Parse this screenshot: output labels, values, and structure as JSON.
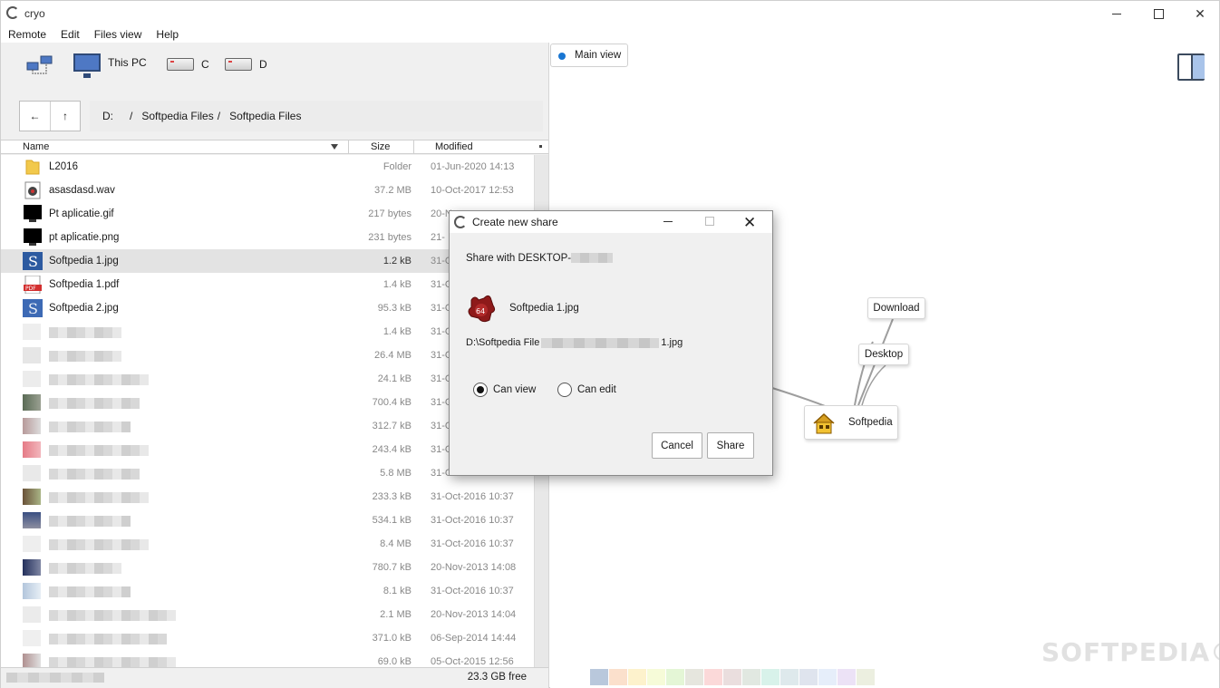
{
  "window": {
    "title": "cryo"
  },
  "menu": [
    "Remote",
    "Edit",
    "Files view",
    "Help"
  ],
  "drives": {
    "this_pc": "This PC",
    "c": "C",
    "d": "D"
  },
  "breadcrumb": {
    "root": "D:",
    "sep": "/",
    "part1": "Softpedia Files",
    "part2": "Softpedia Files"
  },
  "nav": {
    "back": "←",
    "up": "↑"
  },
  "columns": {
    "name": "Name",
    "size": "Size",
    "modified": "Modified"
  },
  "files": [
    {
      "name": "L2016",
      "size": "Folder",
      "modified": "01-Jun-2020  14:13",
      "icon": "folder-icon"
    },
    {
      "name": "asasdasd.wav",
      "size": "37.2 MB",
      "modified": "10-Oct-2017  12:53",
      "icon": "audio-file-icon"
    },
    {
      "name": "Pt aplicatie.gif",
      "size": "217 bytes",
      "modified": "20-N",
      "icon": "image-file-icon"
    },
    {
      "name": "pt aplicatie.png",
      "size": "231 bytes",
      "modified": "21-",
      "icon": "image-file-icon"
    },
    {
      "name": "Softpedia 1.jpg",
      "size": "1.2 kB",
      "modified": "31-O",
      "icon": "softpedia-image-icon",
      "selected": true
    },
    {
      "name": "Softpedia 1.pdf",
      "size": "1.4 kB",
      "modified": "31-O",
      "icon": "pdf-file-icon"
    },
    {
      "name": "Softpedia 2.jpg",
      "size": "95.3 kB",
      "modified": "31-O",
      "icon": "softpedia-image-icon"
    }
  ],
  "blurred_files": [
    {
      "size": "1.4 kB",
      "modified": "31-O"
    },
    {
      "size": "26.4 MB",
      "modified": "31-O"
    },
    {
      "size": "24.1 kB",
      "modified": "31-O"
    },
    {
      "size": "700.4 kB",
      "modified": "31-O"
    },
    {
      "size": "312.7 kB",
      "modified": "31-O"
    },
    {
      "size": "243.4 kB",
      "modified": "31-O"
    },
    {
      "size": "5.8 MB",
      "modified": "31-O"
    },
    {
      "size": "233.3 kB",
      "modified": "31-Oct-2016  10:37"
    },
    {
      "size": "534.1 kB",
      "modified": "31-Oct-2016  10:37"
    },
    {
      "size": "8.4 MB",
      "modified": "31-Oct-2016  10:37"
    },
    {
      "size": "780.7 kB",
      "modified": "20-Nov-2013  14:08"
    },
    {
      "size": "8.1 kB",
      "modified": "31-Oct-2016  10:37"
    },
    {
      "size": "2.1 MB",
      "modified": "20-Nov-2013  14:04"
    },
    {
      "size": "371.0 kB",
      "modified": "06-Sep-2014  14:44"
    },
    {
      "size": "69.0 kB",
      "modified": "05-Oct-2015  12:56"
    }
  ],
  "status": {
    "free": "23.3 GB free"
  },
  "right": {
    "tab": "Main view",
    "nodes": {
      "download": "Download",
      "desktop": "Desktop",
      "softpedia": "Softpedia"
    },
    "watermark": "SOFTPEDIA®"
  },
  "dialog": {
    "title": "Create new share",
    "share_with": "Share with DESKTOP-",
    "filename": "Softpedia 1.jpg",
    "path_start": "D:\\Softpedia File",
    "path_end": "1.jpg",
    "can_view": "Can view",
    "can_edit": "Can edit",
    "selected_permission": "Can view",
    "cancel": "Cancel",
    "share": "Share"
  },
  "colors": {
    "accent": "#1976d2",
    "selection": "#e3e3e3"
  }
}
